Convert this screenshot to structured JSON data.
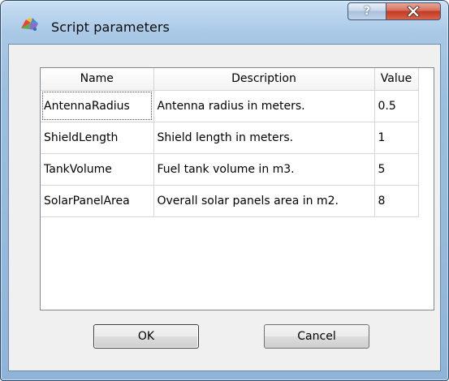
{
  "window": {
    "title": "Script parameters",
    "icons": {
      "app": "script-icon",
      "help": "help-icon",
      "close": "close-icon"
    },
    "help_glyph": "?",
    "accent_colors": {
      "title_bar": "#a9c8e6",
      "close_button": "#c33b22"
    }
  },
  "table": {
    "headers": [
      "Name",
      "Description",
      "Value"
    ],
    "rows": [
      {
        "name": "AntennaRadius",
        "description": "Antenna radius in meters.",
        "value": "0.5"
      },
      {
        "name": "ShieldLength",
        "description": "Shield length in meters.",
        "value": "1"
      },
      {
        "name": "TankVolume",
        "description": "Fuel tank volume in m3.",
        "value": "5"
      },
      {
        "name": "SolarPanelArea",
        "description": "Overall solar panels area in m2.",
        "value": "8"
      }
    ]
  },
  "buttons": {
    "ok": "OK",
    "cancel": "Cancel"
  }
}
